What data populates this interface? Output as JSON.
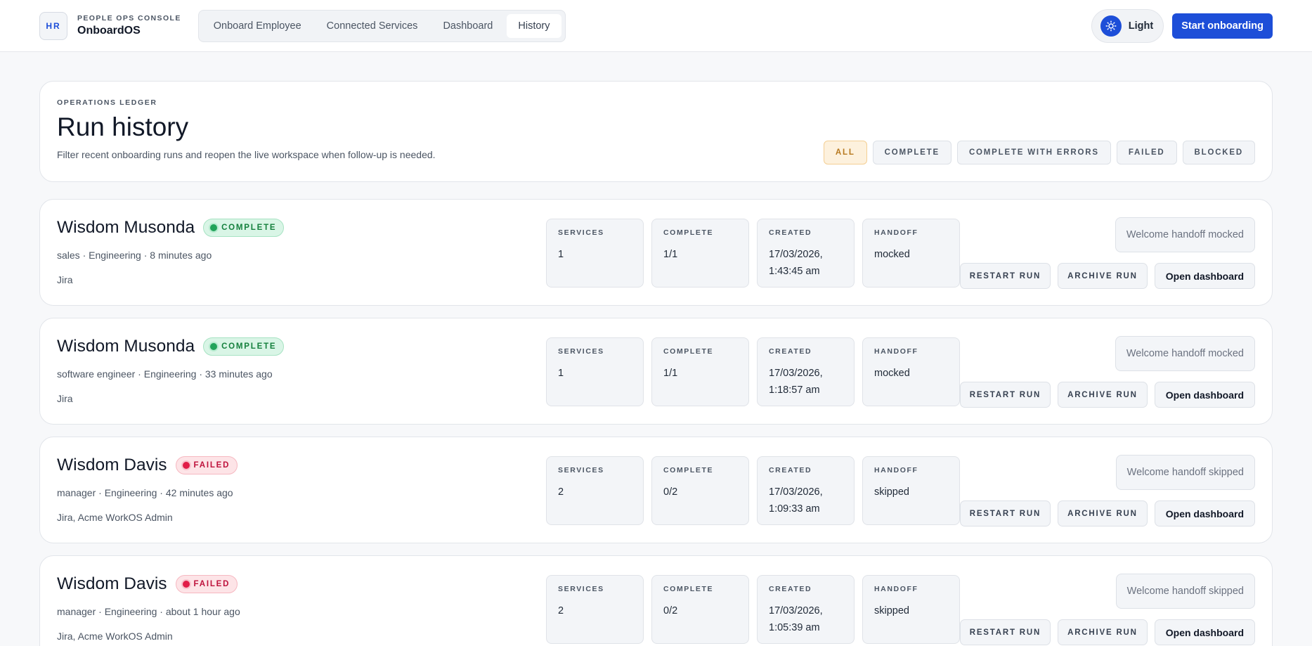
{
  "brand": {
    "badge": "HR",
    "kicker": "PEOPLE OPS CONSOLE",
    "name": "OnboardOS"
  },
  "nav": {
    "tabs": [
      "Onboard Employee",
      "Connected Services",
      "Dashboard",
      "History"
    ],
    "active": "History"
  },
  "theme": {
    "label": "Light",
    "icon": "sun-icon"
  },
  "header": {
    "cta": "Start onboarding"
  },
  "ledger": {
    "kicker": "OPERATIONS LEDGER",
    "title": "Run history",
    "subtitle": "Filter recent onboarding runs and reopen the live workspace when follow-up is needed.",
    "filters": [
      "ALL",
      "COMPLETE",
      "COMPLETE WITH ERRORS",
      "FAILED",
      "BLOCKED"
    ],
    "active_filter": "ALL"
  },
  "stat_labels": {
    "services": "SERVICES",
    "complete": "COMPLETE",
    "created": "CREATED",
    "handoff": "HANDOFF"
  },
  "actions": {
    "restart": "RESTART RUN",
    "archive": "ARCHIVE RUN",
    "open": "Open dashboard"
  },
  "runs": [
    {
      "name": "Wisdom Musonda",
      "status": "COMPLETE",
      "status_kind": "ok",
      "meta": "sales · Engineering · 8 minutes ago",
      "services_list": "Jira",
      "services": "1",
      "complete": "1/1",
      "created": "17/03/2026, 1:43:45 am",
      "handoff": "mocked",
      "note": "Welcome handoff mocked"
    },
    {
      "name": "Wisdom Musonda",
      "status": "COMPLETE",
      "status_kind": "ok",
      "meta": "software engineer · Engineering · 33 minutes ago",
      "services_list": "Jira",
      "services": "1",
      "complete": "1/1",
      "created": "17/03/2026, 1:18:57 am",
      "handoff": "mocked",
      "note": "Welcome handoff mocked"
    },
    {
      "name": "Wisdom Davis",
      "status": "FAILED",
      "status_kind": "fail",
      "meta": "manager · Engineering · 42 minutes ago",
      "services_list": "Jira, Acme WorkOS Admin",
      "services": "2",
      "complete": "0/2",
      "created": "17/03/2026, 1:09:33 am",
      "handoff": "skipped",
      "note": "Welcome handoff skipped"
    },
    {
      "name": "Wisdom Davis",
      "status": "FAILED",
      "status_kind": "fail",
      "meta": "manager · Engineering · about 1 hour ago",
      "services_list": "Jira, Acme WorkOS Admin",
      "services": "2",
      "complete": "0/2",
      "created": "17/03/2026, 1:05:39 am",
      "handoff": "skipped",
      "note": "Welcome handoff skipped"
    }
  ]
}
